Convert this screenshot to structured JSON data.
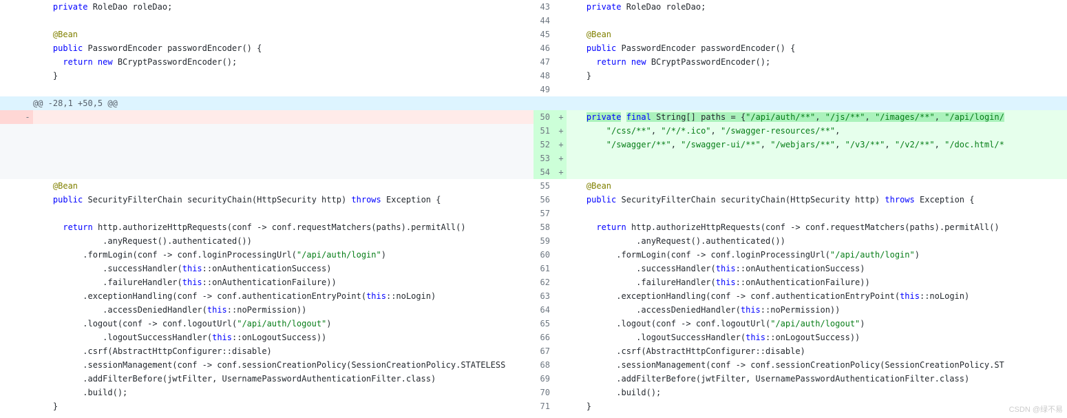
{
  "watermark": "CSDN @绿不易",
  "hunk_header": "@@ -28,1 +50,5 @@",
  "left": [
    {
      "type": "ctx",
      "ln": "",
      "code_html": "    <span class='kwb'>private</span> RoleDao roleDao;"
    },
    {
      "type": "ctx",
      "ln": "",
      "code_html": ""
    },
    {
      "type": "ctx",
      "ln": "",
      "code_html": "    <span class='ann'>@Bean</span>"
    },
    {
      "type": "ctx",
      "ln": "",
      "code_html": "    <span class='kwb'>public</span> PasswordEncoder passwordEncoder() {"
    },
    {
      "type": "ctx",
      "ln": "",
      "code_html": "      <span class='kwb'>return new</span> BCryptPasswordEncoder();"
    },
    {
      "type": "ctx",
      "ln": "",
      "code_html": "    }"
    },
    {
      "type": "ctx",
      "ln": "",
      "code_html": ""
    },
    {
      "type": "hunk"
    },
    {
      "type": "del",
      "ln": "",
      "code_html": ""
    },
    {
      "type": "empty"
    },
    {
      "type": "empty"
    },
    {
      "type": "empty"
    },
    {
      "type": "empty"
    },
    {
      "type": "ctx",
      "ln": "",
      "code_html": "    <span class='ann'>@Bean</span>"
    },
    {
      "type": "ctx",
      "ln": "",
      "code_html": "    <span class='kwb'>public</span> SecurityFilterChain securityChain(HttpSecurity http) <span class='kwb'>throws</span> Exception {"
    },
    {
      "type": "ctx",
      "ln": "",
      "code_html": ""
    },
    {
      "type": "ctx",
      "ln": "",
      "code_html": "      <span class='kwb'>return</span> http.authorizeHttpRequests(conf -> conf.requestMatchers(paths).permitAll()"
    },
    {
      "type": "ctx",
      "ln": "",
      "code_html": "              .anyRequest().authenticated())"
    },
    {
      "type": "ctx",
      "ln": "",
      "code_html": "          .formLogin(conf -> conf.loginProcessingUrl(<span class='str'>\"/api/auth/login\"</span>)"
    },
    {
      "type": "ctx",
      "ln": "",
      "code_html": "              .successHandler(<span class='kwb'>this</span>::onAuthenticationSuccess)"
    },
    {
      "type": "ctx",
      "ln": "",
      "code_html": "              .failureHandler(<span class='kwb'>this</span>::onAuthenticationFailure))"
    },
    {
      "type": "ctx",
      "ln": "",
      "code_html": "          .exceptionHandling(conf -> conf.authenticationEntryPoint(<span class='kwb'>this</span>::noLogin)"
    },
    {
      "type": "ctx",
      "ln": "",
      "code_html": "              .accessDeniedHandler(<span class='kwb'>this</span>::noPermission))"
    },
    {
      "type": "ctx",
      "ln": "",
      "code_html": "          .logout(conf -> conf.logoutUrl(<span class='str'>\"/api/auth/logout\"</span>)"
    },
    {
      "type": "ctx",
      "ln": "",
      "code_html": "              .logoutSuccessHandler(<span class='kwb'>this</span>::onLogoutSuccess))"
    },
    {
      "type": "ctx",
      "ln": "",
      "code_html": "          .csrf(AbstractHttpConfigurer::disable)"
    },
    {
      "type": "ctx",
      "ln": "",
      "code_html": "          .sessionManagement(conf -> conf.sessionCreationPolicy(SessionCreationPolicy.STATELESS"
    },
    {
      "type": "ctx",
      "ln": "",
      "code_html": "          .addFilterBefore(jwtFilter, UsernamePasswordAuthenticationFilter.class)"
    },
    {
      "type": "ctx",
      "ln": "",
      "code_html": "          .build();"
    },
    {
      "type": "ctx",
      "ln": "",
      "code_html": "    }"
    }
  ],
  "right": [
    {
      "type": "ctx",
      "ln": "43",
      "code_html": "    <span class='kwb'>private</span> RoleDao roleDao;"
    },
    {
      "type": "ctx",
      "ln": "44",
      "code_html": ""
    },
    {
      "type": "ctx",
      "ln": "45",
      "code_html": "    <span class='ann'>@Bean</span>"
    },
    {
      "type": "ctx",
      "ln": "46",
      "code_html": "    <span class='kwb'>public</span> PasswordEncoder passwordEncoder() {"
    },
    {
      "type": "ctx",
      "ln": "47",
      "code_html": "      <span class='kwb'>return new</span> BCryptPasswordEncoder();"
    },
    {
      "type": "ctx",
      "ln": "48",
      "code_html": "    }"
    },
    {
      "type": "ctx",
      "ln": "49",
      "code_html": ""
    },
    {
      "type": "hunk"
    },
    {
      "type": "add",
      "ln": "50",
      "code_html": "    <span class='hl-g'><span class='kwb'>private</span></span> <span class='hl-g'><span class='kwb'>final</span> String[] paths = {<span class='str'>\"/api/auth/**\"</span>, <span class='str'>\"/js/**\"</span>, <span class='str'>\"/images/**\"</span>, <span class='str'>\"/api/login/</span></span>"
    },
    {
      "type": "add",
      "ln": "51",
      "code_html": "        <span class='str'>\"/css/**\"</span>, <span class='str'>\"/*/*.ico\"</span>, <span class='str'>\"/swagger-resources/**\"</span>,"
    },
    {
      "type": "add",
      "ln": "52",
      "code_html": "        <span class='str'>\"/swagger/**\"</span>, <span class='str'>\"/swagger-ui/**\"</span>, <span class='str'>\"/webjars/**\"</span>, <span class='str'>\"/v3/**\"</span>, <span class='str'>\"/v2/**\"</span>, <span class='str'>\"/doc.html/*</span>"
    },
    {
      "type": "add",
      "ln": "53",
      "code_html": ""
    },
    {
      "type": "add",
      "ln": "54",
      "code_html": ""
    },
    {
      "type": "ctx",
      "ln": "55",
      "code_html": "    <span class='ann'>@Bean</span>"
    },
    {
      "type": "ctx",
      "ln": "56",
      "code_html": "    <span class='kwb'>public</span> SecurityFilterChain securityChain(HttpSecurity http) <span class='kwb'>throws</span> Exception {"
    },
    {
      "type": "ctx",
      "ln": "57",
      "code_html": ""
    },
    {
      "type": "ctx",
      "ln": "58",
      "code_html": "      <span class='kwb'>return</span> http.authorizeHttpRequests(conf -> conf.requestMatchers(paths).permitAll()"
    },
    {
      "type": "ctx",
      "ln": "59",
      "code_html": "              .anyRequest().authenticated())"
    },
    {
      "type": "ctx",
      "ln": "60",
      "code_html": "          .formLogin(conf -> conf.loginProcessingUrl(<span class='str'>\"/api/auth/login\"</span>)"
    },
    {
      "type": "ctx",
      "ln": "61",
      "code_html": "              .successHandler(<span class='kwb'>this</span>::onAuthenticationSuccess)"
    },
    {
      "type": "ctx",
      "ln": "62",
      "code_html": "              .failureHandler(<span class='kwb'>this</span>::onAuthenticationFailure))"
    },
    {
      "type": "ctx",
      "ln": "63",
      "code_html": "          .exceptionHandling(conf -> conf.authenticationEntryPoint(<span class='kwb'>this</span>::noLogin)"
    },
    {
      "type": "ctx",
      "ln": "64",
      "code_html": "              .accessDeniedHandler(<span class='kwb'>this</span>::noPermission))"
    },
    {
      "type": "ctx",
      "ln": "65",
      "code_html": "          .logout(conf -> conf.logoutUrl(<span class='str'>\"/api/auth/logout\"</span>)"
    },
    {
      "type": "ctx",
      "ln": "66",
      "code_html": "              .logoutSuccessHandler(<span class='kwb'>this</span>::onLogoutSuccess))"
    },
    {
      "type": "ctx",
      "ln": "67",
      "code_html": "          .csrf(AbstractHttpConfigurer::disable)"
    },
    {
      "type": "ctx",
      "ln": "68",
      "code_html": "          .sessionManagement(conf -> conf.sessionCreationPolicy(SessionCreationPolicy.ST"
    },
    {
      "type": "ctx",
      "ln": "69",
      "code_html": "          .addFilterBefore(jwtFilter, UsernamePasswordAuthenticationFilter.class)"
    },
    {
      "type": "ctx",
      "ln": "70",
      "code_html": "          .build();"
    },
    {
      "type": "ctx",
      "ln": "71",
      "code_html": "    }"
    }
  ]
}
